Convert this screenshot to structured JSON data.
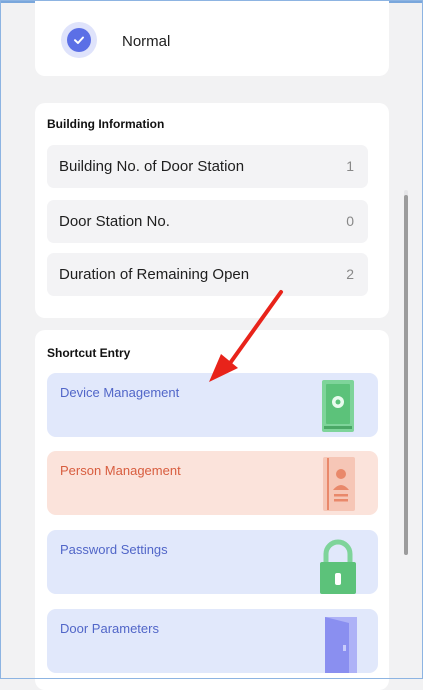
{
  "status": {
    "label": "Normal",
    "icon": "check-badge-icon"
  },
  "building_info": {
    "title": "Building Information",
    "rows": [
      {
        "label": "Building No. of Door Station",
        "value": "1"
      },
      {
        "label": "Door Station No.",
        "value": "0"
      },
      {
        "label": "Duration of Remaining Open",
        "value": "2"
      }
    ]
  },
  "shortcut_entry": {
    "title": "Shortcut Entry",
    "items": [
      {
        "label": "Device Management",
        "icon": "device-tablet-gear-icon",
        "color": "#5166c8"
      },
      {
        "label": "Person Management",
        "icon": "person-card-icon",
        "color": "#d85d3f"
      },
      {
        "label": "Password Settings",
        "icon": "padlock-icon",
        "color": "#5166c8"
      },
      {
        "label": "Door Parameters",
        "icon": "door-icon",
        "color": "#5166c8"
      }
    ]
  },
  "colors": {
    "accent": "#5b6fe6",
    "annotation_arrow": "#e8231a",
    "green_icon": "#5cc27a",
    "orange_icon": "#e9886a",
    "purple_icon": "#8a8ff0"
  }
}
